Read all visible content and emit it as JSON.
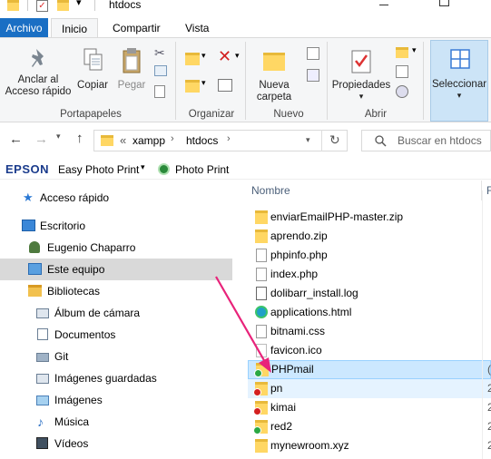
{
  "window": {
    "title": "htdocs"
  },
  "tabs": {
    "archivo": "Archivo",
    "inicio": "Inicio",
    "compartir": "Compartir",
    "vista": "Vista"
  },
  "ribbon": {
    "pin": "Anclar al Acceso rápido",
    "pin_l1": "Anclar al",
    "pin_l2": "Acceso rápido",
    "copy": "Copiar",
    "paste": "Pegar",
    "new_folder_l1": "Nueva",
    "new_folder_l2": "carpeta",
    "properties": "Propiedades",
    "select": "Seleccionar",
    "groups": {
      "clipboard": "Portapapeles",
      "organize": "Organizar",
      "new": "Nuevo",
      "open": "Abrir"
    }
  },
  "address": {
    "overflow": "«",
    "crumbs": [
      "xampp",
      "htdocs"
    ],
    "search_placeholder": "Buscar en htdocs"
  },
  "epson": {
    "brand": "EPSON",
    "easy": "Easy Photo Print",
    "photo": "Photo Print"
  },
  "nav": [
    {
      "label": "Acceso rápido",
      "icon": "star-icon"
    },
    {
      "label": "Escritorio",
      "icon": "desktop-icon"
    },
    {
      "label": "Eugenio Chaparro",
      "icon": "user-icon"
    },
    {
      "label": "Este equipo",
      "icon": "computer-icon"
    },
    {
      "label": "Bibliotecas",
      "icon": "libraries-icon"
    },
    {
      "label": "Álbum de cámara",
      "icon": "library-icon"
    },
    {
      "label": "Documentos",
      "icon": "documents-icon"
    },
    {
      "label": "Git",
      "icon": "git-icon"
    },
    {
      "label": "Imágenes guardadas",
      "icon": "library-icon"
    },
    {
      "label": "Imágenes",
      "icon": "pictures-icon"
    },
    {
      "label": "Música",
      "icon": "music-icon"
    },
    {
      "label": "Vídeos",
      "icon": "videos-icon"
    }
  ],
  "files": {
    "column": "Nombre",
    "items": [
      {
        "name": "enviarEmailPHP-master.zip",
        "icon": "zip-folder-icon",
        "tail": ""
      },
      {
        "name": "aprendo.zip",
        "icon": "zip-folder-icon",
        "tail": ""
      },
      {
        "name": "phpinfo.php",
        "icon": "php-file-icon",
        "tail": ""
      },
      {
        "name": "index.php",
        "icon": "php-file-icon",
        "tail": ""
      },
      {
        "name": "dolibarr_install.log",
        "icon": "log-file-icon",
        "tail": ""
      },
      {
        "name": "applications.html",
        "icon": "edge-html-icon",
        "tail": ""
      },
      {
        "name": "bitnami.css",
        "icon": "css-file-icon",
        "tail": ""
      },
      {
        "name": "favicon.ico",
        "icon": "ico-file-icon",
        "tail": ""
      },
      {
        "name": "PHPmail",
        "icon": "folder-synced-icon",
        "tail": "("
      },
      {
        "name": "pn",
        "icon": "folder-error-icon",
        "tail": "2"
      },
      {
        "name": "kimai",
        "icon": "folder-error-icon",
        "tail": "2"
      },
      {
        "name": "red2",
        "icon": "folder-synced-icon",
        "tail": "2"
      },
      {
        "name": "mynewroom.xyz",
        "icon": "folder-icon",
        "tail": "2"
      }
    ]
  },
  "colors": {
    "accent": "#1a6fc4",
    "selected": "#cce8ff",
    "arrow": "#e8237a"
  }
}
